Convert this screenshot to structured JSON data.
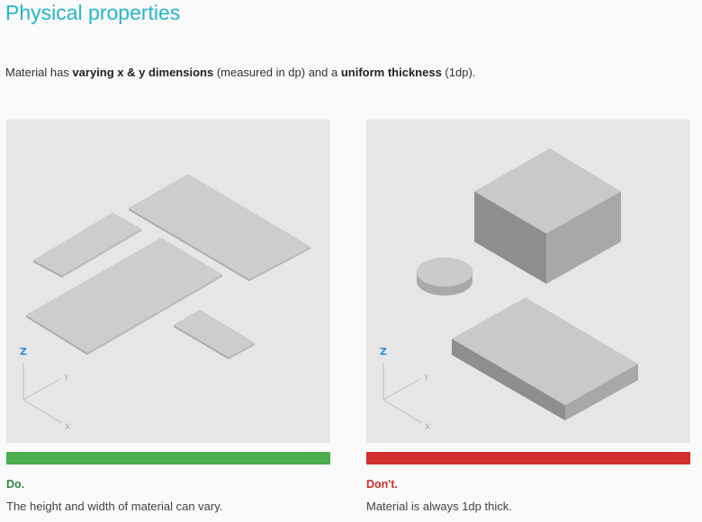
{
  "heading": "Physical properties",
  "intro": {
    "part1": "Material has ",
    "bold1": "varying x & y dimensions",
    "part2": " (measured in dp) and a ",
    "bold2": "uniform thickness",
    "part3": " (1dp)."
  },
  "examples": [
    {
      "verdict": "Do.",
      "caption": "The height and width of material can vary.",
      "status_color": "#4caf50"
    },
    {
      "verdict": "Don't.",
      "caption": "Material is always 1dp thick.",
      "status_color": "#d32f2f"
    }
  ],
  "axes": {
    "z": "Z",
    "y": "Y",
    "x": "X"
  },
  "colors": {
    "heading": "#26b6c9",
    "do_text": "#2e8b3e",
    "dont_text": "#d32f2f",
    "panel_bg": "#e6e6e6"
  }
}
